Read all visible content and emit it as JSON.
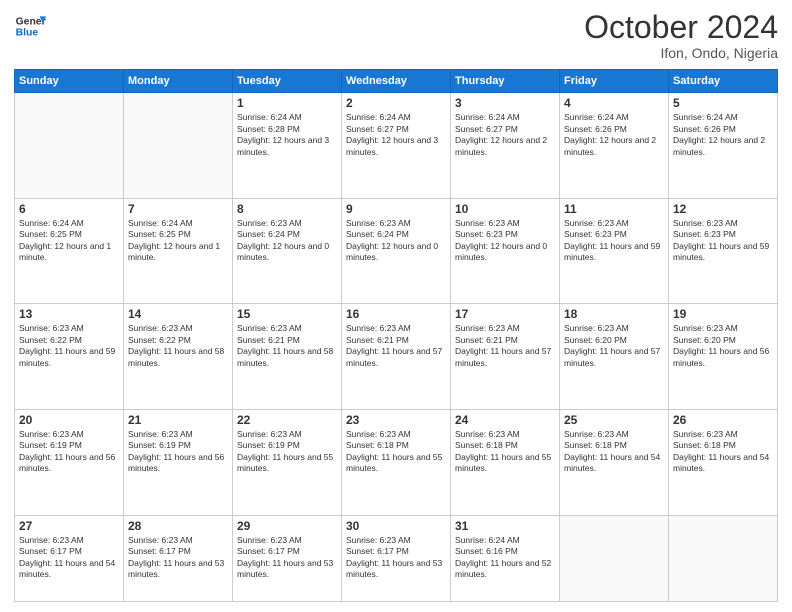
{
  "logo": {
    "line1": "General",
    "line2": "Blue"
  },
  "header": {
    "month": "October 2024",
    "location": "Ifon, Ondo, Nigeria"
  },
  "weekdays": [
    "Sunday",
    "Monday",
    "Tuesday",
    "Wednesday",
    "Thursday",
    "Friday",
    "Saturday"
  ],
  "weeks": [
    [
      {
        "day": "",
        "info": ""
      },
      {
        "day": "",
        "info": ""
      },
      {
        "day": "1",
        "info": "Sunrise: 6:24 AM\nSunset: 6:28 PM\nDaylight: 12 hours and 3 minutes."
      },
      {
        "day": "2",
        "info": "Sunrise: 6:24 AM\nSunset: 6:27 PM\nDaylight: 12 hours and 3 minutes."
      },
      {
        "day": "3",
        "info": "Sunrise: 6:24 AM\nSunset: 6:27 PM\nDaylight: 12 hours and 2 minutes."
      },
      {
        "day": "4",
        "info": "Sunrise: 6:24 AM\nSunset: 6:26 PM\nDaylight: 12 hours and 2 minutes."
      },
      {
        "day": "5",
        "info": "Sunrise: 6:24 AM\nSunset: 6:26 PM\nDaylight: 12 hours and 2 minutes."
      }
    ],
    [
      {
        "day": "6",
        "info": "Sunrise: 6:24 AM\nSunset: 6:25 PM\nDaylight: 12 hours and 1 minute."
      },
      {
        "day": "7",
        "info": "Sunrise: 6:24 AM\nSunset: 6:25 PM\nDaylight: 12 hours and 1 minute."
      },
      {
        "day": "8",
        "info": "Sunrise: 6:23 AM\nSunset: 6:24 PM\nDaylight: 12 hours and 0 minutes."
      },
      {
        "day": "9",
        "info": "Sunrise: 6:23 AM\nSunset: 6:24 PM\nDaylight: 12 hours and 0 minutes."
      },
      {
        "day": "10",
        "info": "Sunrise: 6:23 AM\nSunset: 6:23 PM\nDaylight: 12 hours and 0 minutes."
      },
      {
        "day": "11",
        "info": "Sunrise: 6:23 AM\nSunset: 6:23 PM\nDaylight: 11 hours and 59 minutes."
      },
      {
        "day": "12",
        "info": "Sunrise: 6:23 AM\nSunset: 6:23 PM\nDaylight: 11 hours and 59 minutes."
      }
    ],
    [
      {
        "day": "13",
        "info": "Sunrise: 6:23 AM\nSunset: 6:22 PM\nDaylight: 11 hours and 59 minutes."
      },
      {
        "day": "14",
        "info": "Sunrise: 6:23 AM\nSunset: 6:22 PM\nDaylight: 11 hours and 58 minutes."
      },
      {
        "day": "15",
        "info": "Sunrise: 6:23 AM\nSunset: 6:21 PM\nDaylight: 11 hours and 58 minutes."
      },
      {
        "day": "16",
        "info": "Sunrise: 6:23 AM\nSunset: 6:21 PM\nDaylight: 11 hours and 57 minutes."
      },
      {
        "day": "17",
        "info": "Sunrise: 6:23 AM\nSunset: 6:21 PM\nDaylight: 11 hours and 57 minutes."
      },
      {
        "day": "18",
        "info": "Sunrise: 6:23 AM\nSunset: 6:20 PM\nDaylight: 11 hours and 57 minutes."
      },
      {
        "day": "19",
        "info": "Sunrise: 6:23 AM\nSunset: 6:20 PM\nDaylight: 11 hours and 56 minutes."
      }
    ],
    [
      {
        "day": "20",
        "info": "Sunrise: 6:23 AM\nSunset: 6:19 PM\nDaylight: 11 hours and 56 minutes."
      },
      {
        "day": "21",
        "info": "Sunrise: 6:23 AM\nSunset: 6:19 PM\nDaylight: 11 hours and 56 minutes."
      },
      {
        "day": "22",
        "info": "Sunrise: 6:23 AM\nSunset: 6:19 PM\nDaylight: 11 hours and 55 minutes."
      },
      {
        "day": "23",
        "info": "Sunrise: 6:23 AM\nSunset: 6:18 PM\nDaylight: 11 hours and 55 minutes."
      },
      {
        "day": "24",
        "info": "Sunrise: 6:23 AM\nSunset: 6:18 PM\nDaylight: 11 hours and 55 minutes."
      },
      {
        "day": "25",
        "info": "Sunrise: 6:23 AM\nSunset: 6:18 PM\nDaylight: 11 hours and 54 minutes."
      },
      {
        "day": "26",
        "info": "Sunrise: 6:23 AM\nSunset: 6:18 PM\nDaylight: 11 hours and 54 minutes."
      }
    ],
    [
      {
        "day": "27",
        "info": "Sunrise: 6:23 AM\nSunset: 6:17 PM\nDaylight: 11 hours and 54 minutes."
      },
      {
        "day": "28",
        "info": "Sunrise: 6:23 AM\nSunset: 6:17 PM\nDaylight: 11 hours and 53 minutes."
      },
      {
        "day": "29",
        "info": "Sunrise: 6:23 AM\nSunset: 6:17 PM\nDaylight: 11 hours and 53 minutes."
      },
      {
        "day": "30",
        "info": "Sunrise: 6:23 AM\nSunset: 6:17 PM\nDaylight: 11 hours and 53 minutes."
      },
      {
        "day": "31",
        "info": "Sunrise: 6:24 AM\nSunset: 6:16 PM\nDaylight: 11 hours and 52 minutes."
      },
      {
        "day": "",
        "info": ""
      },
      {
        "day": "",
        "info": ""
      }
    ]
  ]
}
